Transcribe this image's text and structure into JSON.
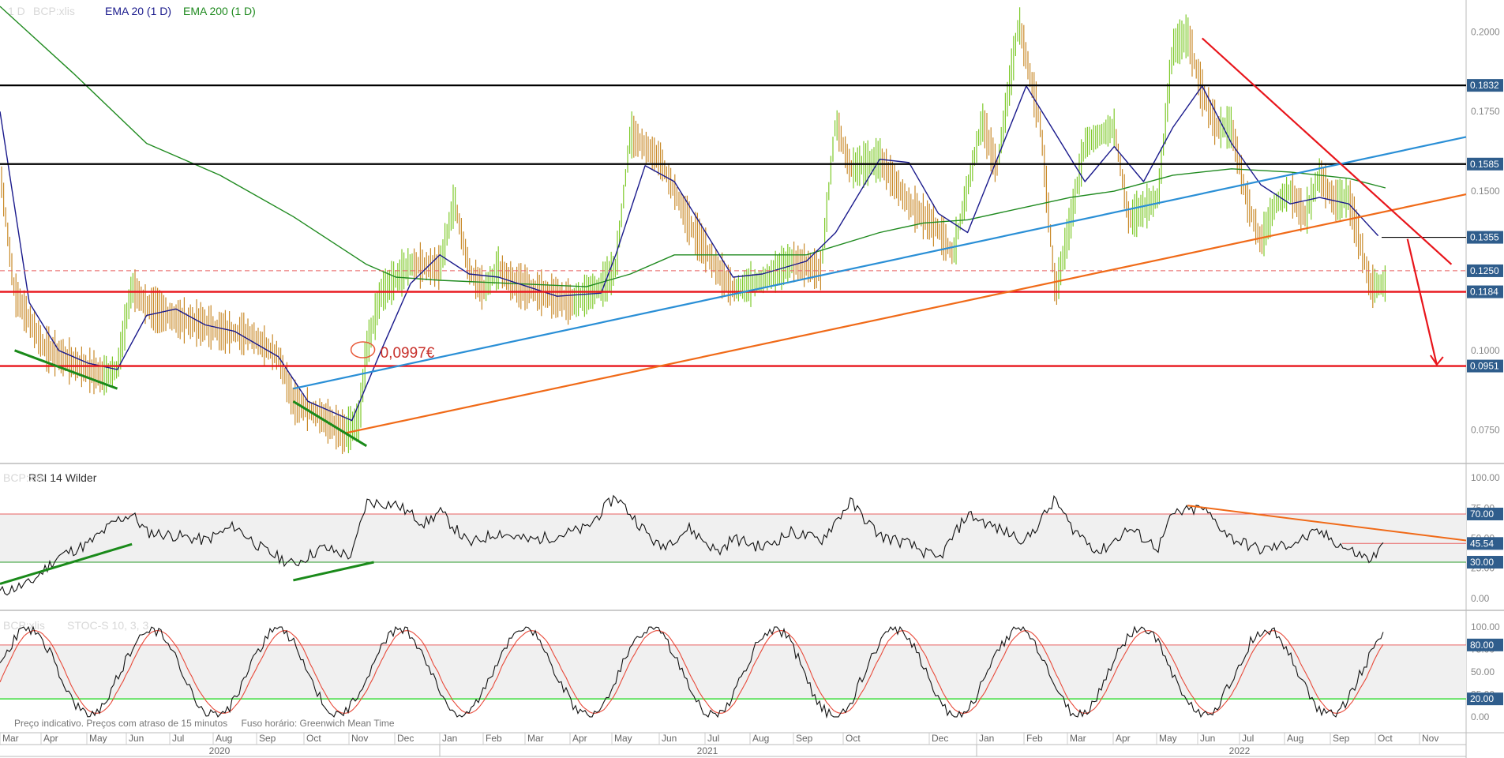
{
  "header": {
    "timeframe": "1 D",
    "symbol": "BCP:xlis",
    "ema20_label": "EMA 20",
    "ema20_tf": "(1 D)",
    "ema200_label": "EMA 200",
    "ema200_tf": "(1 D)"
  },
  "rsi_header": {
    "symbol": "BCP:xlis",
    "label": "RSI 14 Wilder"
  },
  "stoch_header": {
    "symbol": "BCP:xlis",
    "label": "STOC-S 10, 3, 3"
  },
  "footer": {
    "delay_note": "Preço indicativo. Preços com atraso de 15 minutos",
    "timezone_note": "Fuso horário: Greenwich Mean Time"
  },
  "colors": {
    "ema20": "#1a1a8c",
    "ema200": "#1f8a1f",
    "up_bar": "#7ec92a",
    "down_bar": "#c98a2a",
    "support_red": "#e8151b",
    "resistance_black": "#000000",
    "trend_blue": "#2a8fd6",
    "trend_orange": "#f06a18",
    "green_trend": "#1a8a1a",
    "label_bg": "#2f5d8c"
  },
  "chart_data": [
    {
      "type": "line",
      "name": "price",
      "title": "BCP:xlis",
      "ylim": [
        0.065,
        0.21
      ],
      "y_ticks": [
        "0.2000",
        "0.1750",
        "0.1500",
        "0.1000",
        "0.0750"
      ],
      "levels": [
        {
          "value": 0.1832,
          "label": "0.1832",
          "style": "black"
        },
        {
          "value": 0.1585,
          "label": "0.1585",
          "style": "black"
        },
        {
          "value": 0.1355,
          "label": "0.1355",
          "style": "black-short"
        },
        {
          "value": 0.125,
          "label": "0.1250",
          "style": "red-dashed"
        },
        {
          "value": 0.1184,
          "label": "0.1184",
          "style": "red"
        },
        {
          "value": 0.0951,
          "label": "0.0951",
          "style": "red"
        }
      ],
      "annotation": {
        "text": "0,0997€",
        "value": 0.0997
      },
      "x_labels": [
        "Mar",
        "Apr",
        "May",
        "Jun",
        "Jul",
        "Aug",
        "Sep",
        "Oct",
        "Nov",
        "Dec",
        "Jan",
        "Feb",
        "Mar",
        "Apr",
        "May",
        "Jun",
        "Jul",
        "Aug",
        "Sep",
        "Oct",
        "Dec",
        "Jan",
        "Feb",
        "Mar",
        "Apr",
        "May",
        "Jun",
        "Jul",
        "Aug",
        "Sep",
        "Oct",
        "Nov"
      ],
      "year_labels": [
        "2020",
        "2021",
        "2022"
      ],
      "price_path": [
        [
          0,
          0.157
        ],
        [
          0.01,
          0.118
        ],
        [
          0.03,
          0.101
        ],
        [
          0.05,
          0.096
        ],
        [
          0.07,
          0.092
        ],
        [
          0.08,
          0.094
        ],
        [
          0.09,
          0.12
        ],
        [
          0.1,
          0.114
        ],
        [
          0.12,
          0.11
        ],
        [
          0.14,
          0.108
        ],
        [
          0.15,
          0.106
        ],
        [
          0.17,
          0.105
        ],
        [
          0.19,
          0.098
        ],
        [
          0.2,
          0.084
        ],
        [
          0.22,
          0.079
        ],
        [
          0.235,
          0.074
        ],
        [
          0.245,
          0.078
        ],
        [
          0.25,
          0.1
        ],
        [
          0.26,
          0.118
        ],
        [
          0.28,
          0.127
        ],
        [
          0.3,
          0.126
        ],
        [
          0.31,
          0.147
        ],
        [
          0.32,
          0.125
        ],
        [
          0.33,
          0.119
        ],
        [
          0.34,
          0.126
        ],
        [
          0.35,
          0.121
        ],
        [
          0.37,
          0.118
        ],
        [
          0.39,
          0.115
        ],
        [
          0.41,
          0.12
        ],
        [
          0.42,
          0.126
        ],
        [
          0.43,
          0.168
        ],
        [
          0.45,
          0.16
        ],
        [
          0.47,
          0.14
        ],
        [
          0.49,
          0.125
        ],
        [
          0.5,
          0.119
        ],
        [
          0.52,
          0.122
        ],
        [
          0.54,
          0.128
        ],
        [
          0.56,
          0.125
        ],
        [
          0.57,
          0.172
        ],
        [
          0.58,
          0.157
        ],
        [
          0.6,
          0.16
        ],
        [
          0.62,
          0.146
        ],
        [
          0.64,
          0.138
        ],
        [
          0.65,
          0.13
        ],
        [
          0.67,
          0.172
        ],
        [
          0.68,
          0.157
        ],
        [
          0.695,
          0.203
        ],
        [
          0.71,
          0.17
        ],
        [
          0.72,
          0.118
        ],
        [
          0.73,
          0.14
        ],
        [
          0.74,
          0.165
        ],
        [
          0.76,
          0.17
        ],
        [
          0.77,
          0.141
        ],
        [
          0.79,
          0.148
        ],
        [
          0.8,
          0.195
        ],
        [
          0.81,
          0.199
        ],
        [
          0.82,
          0.181
        ],
        [
          0.83,
          0.17
        ],
        [
          0.84,
          0.17
        ],
        [
          0.85,
          0.148
        ],
        [
          0.86,
          0.134
        ],
        [
          0.87,
          0.146
        ],
        [
          0.88,
          0.15
        ],
        [
          0.89,
          0.142
        ],
        [
          0.9,
          0.155
        ],
        [
          0.91,
          0.147
        ],
        [
          0.92,
          0.148
        ],
        [
          0.935,
          0.12
        ],
        [
          0.945,
          0.121
        ]
      ],
      "ema20_path": [
        [
          0,
          0.175
        ],
        [
          0.02,
          0.115
        ],
        [
          0.04,
          0.1
        ],
        [
          0.06,
          0.096
        ],
        [
          0.08,
          0.094
        ],
        [
          0.1,
          0.111
        ],
        [
          0.12,
          0.113
        ],
        [
          0.14,
          0.108
        ],
        [
          0.16,
          0.106
        ],
        [
          0.19,
          0.098
        ],
        [
          0.21,
          0.084
        ],
        [
          0.24,
          0.078
        ],
        [
          0.26,
          0.1
        ],
        [
          0.28,
          0.121
        ],
        [
          0.3,
          0.13
        ],
        [
          0.32,
          0.124
        ],
        [
          0.34,
          0.123
        ],
        [
          0.36,
          0.12
        ],
        [
          0.38,
          0.117
        ],
        [
          0.41,
          0.118
        ],
        [
          0.42,
          0.13
        ],
        [
          0.44,
          0.158
        ],
        [
          0.46,
          0.153
        ],
        [
          0.48,
          0.138
        ],
        [
          0.5,
          0.123
        ],
        [
          0.52,
          0.124
        ],
        [
          0.55,
          0.128
        ],
        [
          0.57,
          0.137
        ],
        [
          0.6,
          0.16
        ],
        [
          0.62,
          0.159
        ],
        [
          0.64,
          0.143
        ],
        [
          0.66,
          0.137
        ],
        [
          0.68,
          0.16
        ],
        [
          0.7,
          0.183
        ],
        [
          0.72,
          0.168
        ],
        [
          0.74,
          0.153
        ],
        [
          0.76,
          0.164
        ],
        [
          0.78,
          0.153
        ],
        [
          0.8,
          0.17
        ],
        [
          0.82,
          0.183
        ],
        [
          0.84,
          0.165
        ],
        [
          0.86,
          0.152
        ],
        [
          0.88,
          0.146
        ],
        [
          0.9,
          0.148
        ],
        [
          0.92,
          0.146
        ],
        [
          0.94,
          0.136
        ]
      ],
      "ema200_path": [
        [
          0,
          0.208
        ],
        [
          0.05,
          0.187
        ],
        [
          0.1,
          0.165
        ],
        [
          0.15,
          0.155
        ],
        [
          0.2,
          0.142
        ],
        [
          0.25,
          0.127
        ],
        [
          0.27,
          0.123
        ],
        [
          0.3,
          0.122
        ],
        [
          0.35,
          0.121
        ],
        [
          0.4,
          0.12
        ],
        [
          0.43,
          0.124
        ],
        [
          0.46,
          0.13
        ],
        [
          0.5,
          0.13
        ],
        [
          0.55,
          0.13
        ],
        [
          0.6,
          0.137
        ],
        [
          0.63,
          0.14
        ],
        [
          0.66,
          0.141
        ],
        [
          0.7,
          0.145
        ],
        [
          0.73,
          0.148
        ],
        [
          0.76,
          0.15
        ],
        [
          0.8,
          0.155
        ],
        [
          0.84,
          0.157
        ],
        [
          0.88,
          0.156
        ],
        [
          0.92,
          0.154
        ],
        [
          0.945,
          0.151
        ]
      ],
      "trend_lines": [
        {
          "color": "blue",
          "from": [
            0.2,
            0.088
          ],
          "to": [
            1.0,
            0.167
          ]
        },
        {
          "color": "orange",
          "from": [
            0.235,
            0.074
          ],
          "to": [
            1.0,
            0.149
          ]
        },
        {
          "color": "red",
          "from": [
            0.82,
            0.198
          ],
          "to": [
            0.99,
            0.127
          ]
        },
        {
          "color": "green",
          "from": [
            0.01,
            0.1
          ],
          "to": [
            0.08,
            0.088
          ]
        },
        {
          "color": "green",
          "from": [
            0.2,
            0.084
          ],
          "to": [
            0.25,
            0.07
          ]
        }
      ],
      "forecast_arrow": {
        "from": [
          0.96,
          0.135
        ],
        "to": [
          0.98,
          0.0955
        ]
      }
    },
    {
      "type": "line",
      "name": "RSI 14 Wilder",
      "ylim": [
        0,
        100
      ],
      "y_ticks": [
        "100.00",
        "75.00",
        "50.00",
        "25.00",
        "0.00"
      ],
      "levels": [
        {
          "value": 70,
          "label": "70.00"
        },
        {
          "value": 30,
          "label": "30.00"
        }
      ],
      "current": {
        "value": 45.54,
        "label": "45.54"
      },
      "rsi_path": [
        [
          0,
          5
        ],
        [
          0.02,
          12
        ],
        [
          0.04,
          35
        ],
        [
          0.06,
          45
        ],
        [
          0.08,
          65
        ],
        [
          0.09,
          70
        ],
        [
          0.1,
          55
        ],
        [
          0.12,
          52
        ],
        [
          0.14,
          48
        ],
        [
          0.16,
          60
        ],
        [
          0.18,
          40
        ],
        [
          0.2,
          28
        ],
        [
          0.22,
          42
        ],
        [
          0.24,
          35
        ],
        [
          0.25,
          80
        ],
        [
          0.27,
          78
        ],
        [
          0.29,
          62
        ],
        [
          0.3,
          72
        ],
        [
          0.32,
          45
        ],
        [
          0.34,
          55
        ],
        [
          0.36,
          48
        ],
        [
          0.38,
          52
        ],
        [
          0.4,
          58
        ],
        [
          0.42,
          85
        ],
        [
          0.43,
          70
        ],
        [
          0.45,
          42
        ],
        [
          0.47,
          58
        ],
        [
          0.49,
          38
        ],
        [
          0.5,
          50
        ],
        [
          0.52,
          42
        ],
        [
          0.54,
          55
        ],
        [
          0.56,
          48
        ],
        [
          0.58,
          80
        ],
        [
          0.6,
          52
        ],
        [
          0.62,
          45
        ],
        [
          0.64,
          32
        ],
        [
          0.66,
          70
        ],
        [
          0.68,
          58
        ],
        [
          0.7,
          48
        ],
        [
          0.72,
          82
        ],
        [
          0.73,
          60
        ],
        [
          0.75,
          38
        ],
        [
          0.77,
          58
        ],
        [
          0.79,
          42
        ],
        [
          0.8,
          70
        ],
        [
          0.82,
          75
        ],
        [
          0.84,
          50
        ],
        [
          0.86,
          40
        ],
        [
          0.88,
          45
        ],
        [
          0.9,
          55
        ],
        [
          0.92,
          40
        ],
        [
          0.935,
          32
        ],
        [
          0.945,
          45
        ]
      ],
      "trend_lines": [
        {
          "color": "orange",
          "from": [
            0.81,
            77
          ],
          "to": [
            1.0,
            48
          ]
        },
        {
          "color": "green",
          "from": [
            0.0,
            12
          ],
          "to": [
            0.09,
            45
          ]
        },
        {
          "color": "green",
          "from": [
            0.2,
            15
          ],
          "to": [
            0.255,
            30
          ]
        }
      ]
    },
    {
      "type": "line",
      "name": "STOC-S 10, 3, 3",
      "ylim": [
        0,
        100
      ],
      "y_ticks": [
        "100.00",
        "75.00",
        "50.00",
        "25.00",
        "0.00"
      ],
      "levels": [
        {
          "value": 80,
          "label": "80.00"
        },
        {
          "value": 20,
          "label": "20.00"
        }
      ]
    }
  ]
}
